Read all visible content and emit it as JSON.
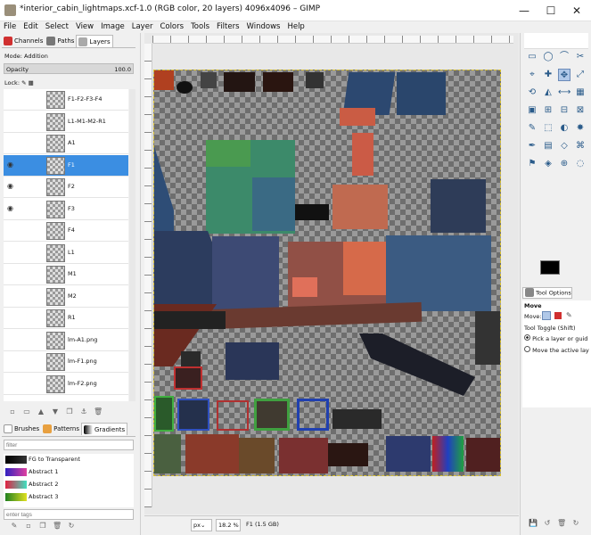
{
  "window": {
    "title": "*interior_cabin_lightmaps.xcf-1.0 (RGB color, 20 layers) 4096x4096 – GIMP",
    "minimize": "—",
    "maximize": "☐",
    "close": "✕"
  },
  "menu": [
    "File",
    "Edit",
    "Select",
    "View",
    "Image",
    "Layer",
    "Colors",
    "Tools",
    "Filters",
    "Windows",
    "Help"
  ],
  "layers_dock": {
    "tabs": [
      "Channels",
      "Paths",
      "Layers"
    ],
    "mode_label": "Mode:",
    "mode_value": "Addition",
    "opacity_label": "Opacity",
    "opacity_value": "100.0",
    "lock_label": "Lock:",
    "layers": [
      {
        "name": "F1-F2-F3-F4",
        "visible": false,
        "selected": false
      },
      {
        "name": "L1-M1-M2-R1",
        "visible": false,
        "selected": false
      },
      {
        "name": "A1",
        "visible": false,
        "selected": false
      },
      {
        "name": "F1",
        "visible": true,
        "selected": true
      },
      {
        "name": "F2",
        "visible": true,
        "selected": false
      },
      {
        "name": "F3",
        "visible": true,
        "selected": false
      },
      {
        "name": "F4",
        "visible": false,
        "selected": false
      },
      {
        "name": "L1",
        "visible": false,
        "selected": false
      },
      {
        "name": "M1",
        "visible": false,
        "selected": false
      },
      {
        "name": "M2",
        "visible": false,
        "selected": false
      },
      {
        "name": "R1",
        "visible": false,
        "selected": false
      },
      {
        "name": "lm-A1.png",
        "visible": false,
        "selected": false
      },
      {
        "name": "lm-F1.png",
        "visible": false,
        "selected": false
      },
      {
        "name": "lm-F2.png",
        "visible": false,
        "selected": false
      }
    ],
    "eye_icon": "eye-icon"
  },
  "brushes_dock": {
    "tabs": [
      "Brushes",
      "Patterns",
      "Gradients"
    ],
    "filter_placeholder": "filter",
    "tags_placeholder": "enter tags",
    "items": [
      {
        "name": "FG to Transparent",
        "colors": [
          "#000000",
          "#333333"
        ]
      },
      {
        "name": "Abstract 1",
        "colors": [
          "#3020c0",
          "#e040a0"
        ]
      },
      {
        "name": "Abstract 2",
        "colors": [
          "#e02040",
          "#40e0c0"
        ]
      },
      {
        "name": "Abstract 3",
        "colors": [
          "#208020",
          "#e0e020"
        ]
      }
    ]
  },
  "status": {
    "unit": "px",
    "zoom": "18.2 %",
    "info": "F1 (1.5 GB)"
  },
  "tool_options": {
    "tab": "Tool Options",
    "tool_name": "Move",
    "move_label": "Move:",
    "toggle_label": "Tool Toggle  (Shift)",
    "options": [
      {
        "label": "Pick a layer or guid",
        "checked": true
      },
      {
        "label": "Move the active lay",
        "checked": false
      }
    ]
  },
  "colors": {
    "fg": "#000000",
    "bg": "#ffffff",
    "selection": "#3b8ee2"
  }
}
